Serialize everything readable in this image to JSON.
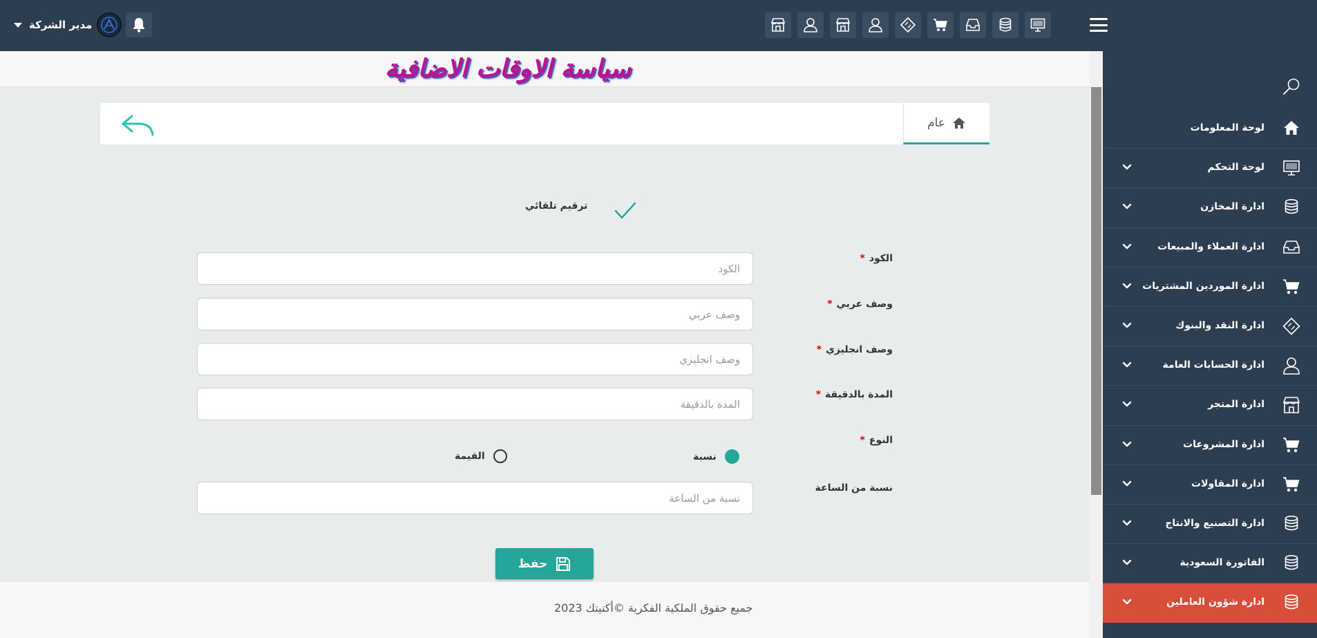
{
  "header": {
    "user_name": "مدير الشركة",
    "quick_icons": [
      "store-icon",
      "user-icon",
      "store-icon",
      "user-icon",
      "ticket-icon",
      "cart-icon",
      "inbox-icon",
      "database-icon",
      "monitor-icon"
    ]
  },
  "page": {
    "title": "سياسة الاوقات الاضافية",
    "tab_general": "عام"
  },
  "form": {
    "auto_numbering_label": "ترقيم تلقائي",
    "code": {
      "label": "الكود",
      "placeholder": "الكود",
      "value": ""
    },
    "arabic_desc": {
      "label": "وصف عربي",
      "placeholder": "وصف عربي",
      "value": ""
    },
    "english_desc": {
      "label": "وصف انجليزي",
      "placeholder": "وصف انجليزي",
      "value": ""
    },
    "duration": {
      "label": "المدة بالدقيقة",
      "placeholder": "المدة بالدقيقة",
      "value": ""
    },
    "type": {
      "label": "النوع",
      "options": [
        "نسبة",
        "القيمة"
      ],
      "selected": "نسبة"
    },
    "hour_ratio": {
      "label": "نسبة من الساعة",
      "placeholder": "نسبة من الساعة",
      "value": ""
    },
    "save_label": "حفظ"
  },
  "sidebar": {
    "items": [
      {
        "label": "لوحة المعلومات",
        "icon": "home-icon",
        "chevron": false
      },
      {
        "label": "لوحة التحكم",
        "icon": "monitor-icon",
        "chevron": true
      },
      {
        "label": "ادارة المخازن",
        "icon": "database-icon",
        "chevron": true
      },
      {
        "label": "ادارة العملاء والمبيعات",
        "icon": "inbox-icon",
        "chevron": true
      },
      {
        "label": "ادارة الموردين المشتريات",
        "icon": "cart-icon",
        "chevron": true
      },
      {
        "label": "ادارة النقد والبنوك",
        "icon": "ticket-icon",
        "chevron": true
      },
      {
        "label": "ادارة الحسابات العامة",
        "icon": "user-icon",
        "chevron": true
      },
      {
        "label": "ادارة المتجر",
        "icon": "store-icon",
        "chevron": true
      },
      {
        "label": "ادارة المشروعات",
        "icon": "cart-icon",
        "chevron": true
      },
      {
        "label": "ادارة المقاولات",
        "icon": "cart-icon",
        "chevron": true
      },
      {
        "label": "ادارة التصنيع والانتاج",
        "icon": "database-icon",
        "chevron": true
      },
      {
        "label": "الفاتورة السعودية",
        "icon": "database-icon",
        "chevron": true
      },
      {
        "label": "ادارة شؤون العاملين",
        "icon": "database-icon",
        "chevron": true,
        "active": true
      }
    ]
  },
  "footer": {
    "copyright": "جميع حقوق الملكية الفكرية ©أكتيتك 2023"
  },
  "colors": {
    "navy": "#2c3e50",
    "teal": "#26a69a",
    "active_red": "#d94d3b",
    "title_magenta": "#c0128c",
    "required": "#e00000"
  }
}
